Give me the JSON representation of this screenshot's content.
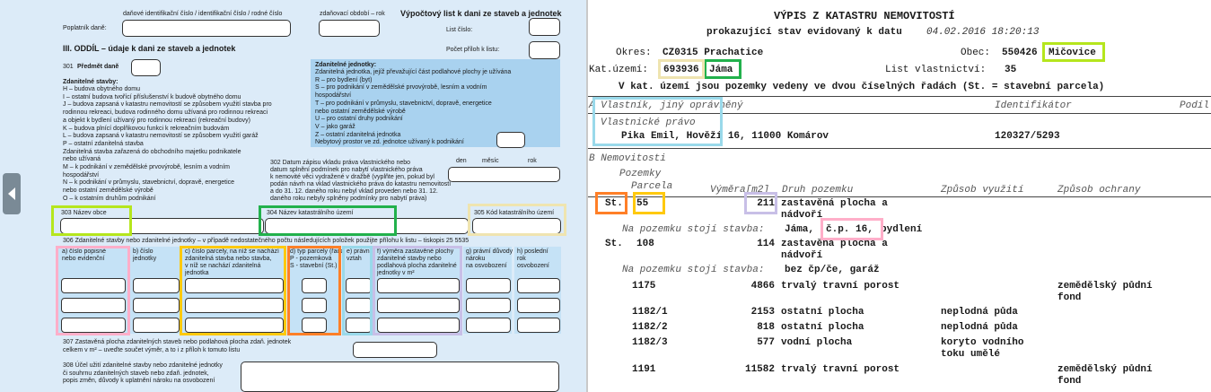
{
  "form": {
    "hdr_ids": "daňové identifikační číslo / identifikační číslo / rodné číslo",
    "hdr_period": "zdaňovací období – rok",
    "title": "Výpočtový list k dani ze staveb a jednotek",
    "poplatnik": "Poplatník daně:",
    "list_cislo": "List číslo:",
    "pocet_priloh": "Počet příloh k listu:",
    "section": "III. ODDÍL – údaje k dani ze staveb a jednotek",
    "r301": "301",
    "r301_label": "Předmět daně",
    "stavby_head": "Zdanitelné stavby:",
    "stavby_lines": [
      "H – budova obytného domu",
      "I – ostatní budova tvořící příslušenství k budově obytného domu",
      "J – budova zapsaná v katastru nemovitostí se způsobem využití stavba pro",
      "      rodinnou rekreaci, budova rodinného domu užívaná pro rodinnou rekreaci",
      "      a objekt k bydlení užívaný pro rodinnou rekreaci (rekreační budovy)",
      "K – budova plnící doplňkovou funkci k rekreačním budovám",
      "L – budova zapsaná v katastru nemovitostí se způsobem využití garáž",
      "P – ostatní zdanitelná stavba",
      "Zdanitelná stavba zařazená do obchodního majetku podnikatele",
      "nebo užívaná",
      "M – k podnikání v zemědělské prvovýrobě, lesním a vodním",
      "       hospodářství",
      "N – k podnikání v průmyslu, stavebnictví, dopravě, energetice",
      "       nebo ostatní zemědělské výrobě",
      "O – k ostatním druhům podnikání"
    ],
    "jednotky_head": "Zdanitelné jednotky:",
    "jednotky_lines": [
      "Zdanitelná jednotka, jejíž převažující část podlahové plochy je užívána",
      "R – pro bydlení (byt)",
      "S – pro podnikání v zemědělské prvovýrobě, lesním a vodním",
      "       hospodářství",
      "T – pro podnikání v průmyslu, stavebnictví, dopravě, energetice",
      "       nebo ostatní zemědělské výrobě",
      "U – pro ostatní druhy podnikání",
      "V – jako garáž",
      "Z – ostatní zdanitelná jednotka",
      "Nebytový prostor ve zd. jednotce užívaný k podnikání"
    ],
    "date_den": "den",
    "date_mesic": "měsíc",
    "date_rok": "rok",
    "r302_lines": [
      "302 Datum zápisu vkladu práva vlastnického nebo",
      "datum splnění podmínek pro nabytí vlastnického práva",
      "k nemovité věci vydražené v dražbě (vyplňte jen, pokud byl",
      "podán návrh na vklad vlastnického práva do katastru nemovitostí",
      "a do 31. 12. daného roku nebyl vklad proveden nebo 31. 12.",
      "daného roku nebyly splněny podmínky pro nabytí práva)"
    ],
    "r303": "303 Název obce",
    "r304": "304 Název katastrálního území",
    "r305": "305 Kód katastrálního území",
    "r306": "306 Zdanitelné stavby nebo zdanitelné jednotky – v případě nedostatečného počtu následujících položek použijte přílohu k listu – tiskopis 25 5535",
    "col_a": [
      "a) číslo popisné",
      "nebo evidenční"
    ],
    "col_b": [
      "b) číslo",
      "jednotky"
    ],
    "col_c": [
      "c) číslo parcely, na níž se nachází",
      "zdanitelná stavba nebo stavba,",
      "v níž se nachází zdanitelná",
      "jednotka"
    ],
    "col_d": [
      "d) typ parcely (řada",
      "P - pozemková",
      "S - stavební (St.)"
    ],
    "col_e": [
      "e) právní",
      "vztah"
    ],
    "col_f": [
      "f) výměra zastavěné plochy",
      "zdanitelné stavby nebo",
      "podlahová plocha zdanitelné",
      "jednotky v m²"
    ],
    "col_g": [
      "g) právní důvody",
      "nároku",
      "na osvobození"
    ],
    "col_h": [
      "h) poslední",
      "rok",
      "osvobození"
    ],
    "r307_lines": [
      "307 Zastavěná plocha zdanitelných staveb nebo podlahová plocha zdaň. jednotek",
      "celkem v m² – uveďte součet výměr, a to i z příloh k tomuto listu"
    ],
    "r308_lines": [
      "308 Účel užití zdanitelné stavby nebo zdanitelné jednotky",
      "či souhrnu zdanitelných staveb nebo zdaň. jednotek,",
      "popis změn, důvody k uplatnění nároku na osvobození"
    ]
  },
  "extract": {
    "title": "VÝPIS Z KATASTRU NEMOVITOSTÍ",
    "subtitle_prefix": "prokazující stav evidovaný k datu",
    "subtitle_date": "04.02.2016 18:20:13",
    "okres_label": "Okres:",
    "okres_value": "CZ0315 Prachatice",
    "obec_label": "Obec:",
    "obec_code": "550426",
    "obec_name": "Mičovice",
    "katuzemi_label": "Kat.území:",
    "katuzemi_code": "693936",
    "katuzemi_name": "Jáma",
    "list_label": "List vlastnictví:",
    "list_value": "35",
    "note": "V kat. území jsou pozemky vedeny ve dvou číselných řadách (St. = stavební parcela)",
    "sec_a": "A  Vlastník, jiný oprávněný",
    "identifikator": "Identifikátor",
    "podil": "Podíl",
    "vlastnicke_pravo": "Vlastnické právo",
    "owner": "Pika Emil, Hověží 16, 11000 Komárov",
    "owner_id": "120327/5293",
    "sec_b": "B  Nemovitosti",
    "h_pozemky": "Pozemky",
    "h_parcela": "Parcela",
    "h_vymera": "Výměra[m2]",
    "h_druh": "Druh pozemku",
    "h_zpusob_vyuziti": "Způsob využití",
    "h_zpusob_ochrany": "Způsob ochrany",
    "stavba_label": "Na pozemku stojí stavba:",
    "rows": [
      {
        "typ": "St.",
        "num": "55",
        "vymera": "211",
        "druh": "zastavěná plocha a",
        "druh2": "nádvoří",
        "vyuziti": "",
        "vyuziti2": "",
        "ochrana": "",
        "ochrana2": ""
      },
      {
        "typ": "St.",
        "num": "108",
        "vymera": "114",
        "druh": "zastavěná plocha a",
        "druh2": "nádvoří",
        "vyuziti": "",
        "vyuziti2": "",
        "ochrana": "",
        "ochrana2": ""
      },
      {
        "typ": "",
        "num": "1175",
        "vymera": "4866",
        "druh": "trvalý travní porost",
        "druh2": "",
        "vyuziti": "",
        "vyuziti2": "",
        "ochrana": "zemědělský půdní",
        "ochrana2": "fond"
      },
      {
        "typ": "",
        "num": "1182/1",
        "vymera": "2153",
        "druh": "ostatní plocha",
        "druh2": "",
        "vyuziti": "neplodná půda",
        "vyuziti2": "",
        "ochrana": "",
        "ochrana2": ""
      },
      {
        "typ": "",
        "num": "1182/2",
        "vymera": "818",
        "druh": "ostatní plocha",
        "druh2": "",
        "vyuziti": "neplodná půda",
        "vyuziti2": "",
        "ochrana": "",
        "ochrana2": ""
      },
      {
        "typ": "",
        "num": "1182/3",
        "vymera": "577",
        "druh": "vodní plocha",
        "druh2": "",
        "vyuziti": "koryto vodního",
        "vyuziti2": "toku umělé",
        "ochrana": "",
        "ochrana2": ""
      },
      {
        "typ": "",
        "num": "1191",
        "vymera": "11582",
        "druh": "trvalý travní porost",
        "druh2": "",
        "vyuziti": "",
        "vyuziti2": "",
        "ochrana": "zemědělský půdní",
        "ochrana2": "fond"
      }
    ],
    "stavba1_prefix": "Jáma,",
    "stavba1_cp": "č.p. 16,",
    "stavba1_suffix": "bydlení",
    "stavba2": "bez čp/če, garáž"
  },
  "colors": {
    "lime": "#b5e61d",
    "green": "#22b14c",
    "tan": "#efe4b0",
    "lightblue": "#99d9ea",
    "pink": "#ffaec9",
    "yellow": "#ffc90e",
    "orange": "#ff7f27",
    "lavender": "#c8bfe7",
    "form_bg": "#dcebf8"
  },
  "icons": {
    "prev_page": "chevron-left-icon"
  }
}
